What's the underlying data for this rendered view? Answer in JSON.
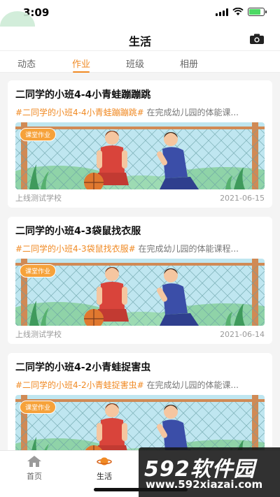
{
  "status": {
    "time": "3:09"
  },
  "header": {
    "title": "生活",
    "camera_icon": "camera-icon"
  },
  "tabs": [
    {
      "label": "动态"
    },
    {
      "label": "作业",
      "active": true
    },
    {
      "label": "班级"
    },
    {
      "label": "相册"
    }
  ],
  "cards": [
    {
      "title": "二同学的小班4-4小青蛙蹦蹦跳",
      "tag": "#二同学的小班4-4小青蛙蹦蹦跳#",
      "desc": " 在完成幼儿园的体能课...",
      "badge": "课堂作业",
      "school": "上线测试学校",
      "date": "2021-06-15"
    },
    {
      "title": "二同学的小班4-3袋鼠找衣服",
      "tag": "#二同学的小班4-3袋鼠找衣服#",
      "desc": " 在完成幼儿园的体能课程...",
      "badge": "课堂作业",
      "school": "上线测试学校",
      "date": "2021-06-14"
    },
    {
      "title": "二同学的小班4-2小青蛙捉害虫",
      "tag": "#二同学的小班4-2小青蛙捉害虫#",
      "desc": " 在完成幼儿园的体能课...",
      "badge": "课堂作业",
      "school": "",
      "date": ""
    }
  ],
  "nav": [
    {
      "label": "首页",
      "icon": "home-icon"
    },
    {
      "label": "生活",
      "icon": "planet-icon",
      "active": true
    }
  ],
  "watermark": {
    "brand_num": "592",
    "brand_cn": "软件园",
    "url": "www.592xiazai.com"
  },
  "colors": {
    "accent": "#f08a24",
    "badge": "#f6a23a",
    "background": "#f4f4f4"
  }
}
